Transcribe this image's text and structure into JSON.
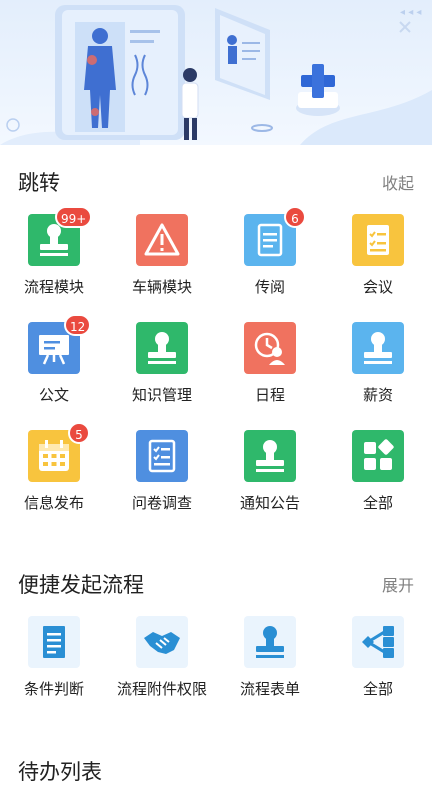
{
  "jump": {
    "title": "跳转",
    "action": "收起",
    "tiles": [
      {
        "label": "流程模块",
        "badge": "99+",
        "color": "#2fb86b",
        "icon": "stamp-icon"
      },
      {
        "label": "车辆模块",
        "badge": "",
        "color": "#f0725f",
        "icon": "warning-icon"
      },
      {
        "label": "传阅",
        "badge": "6",
        "color": "#5bb4ee",
        "icon": "document-icon"
      },
      {
        "label": "会议",
        "badge": "",
        "color": "#f8c43e",
        "icon": "checklist-icon"
      },
      {
        "label": "公文",
        "badge": "12",
        "color": "#4f8fe0",
        "icon": "presentation-icon"
      },
      {
        "label": "知识管理",
        "badge": "",
        "color": "#2fb86b",
        "icon": "stamp-icon"
      },
      {
        "label": "日程",
        "badge": "",
        "color": "#f0725f",
        "icon": "schedule-icon"
      },
      {
        "label": "薪资",
        "badge": "",
        "color": "#5bb4ee",
        "icon": "stamp-icon"
      },
      {
        "label": "信息发布",
        "badge": "5",
        "color": "#f8c43e",
        "icon": "calendar-icon"
      },
      {
        "label": "问卷调查",
        "badge": "",
        "color": "#4f8fe0",
        "icon": "questionnaire-icon"
      },
      {
        "label": "通知公告",
        "badge": "",
        "color": "#2fb86b",
        "icon": "stamp-icon"
      },
      {
        "label": "全部",
        "badge": "",
        "color": "#2fb86b",
        "icon": "grid-icon"
      }
    ]
  },
  "quick": {
    "title": "便捷发起流程",
    "action": "展开",
    "tiles": [
      {
        "label": "条件判断",
        "icon": "document-lines-icon"
      },
      {
        "label": "流程附件权限",
        "icon": "handshake-icon"
      },
      {
        "label": "流程表单",
        "icon": "stamp-icon"
      },
      {
        "label": "全部",
        "icon": "share-nodes-icon"
      }
    ]
  },
  "todo": {
    "title": "待办列表"
  },
  "colors": {
    "quick_icon": "#2a8fd4",
    "badge": "#ea4a3f"
  }
}
